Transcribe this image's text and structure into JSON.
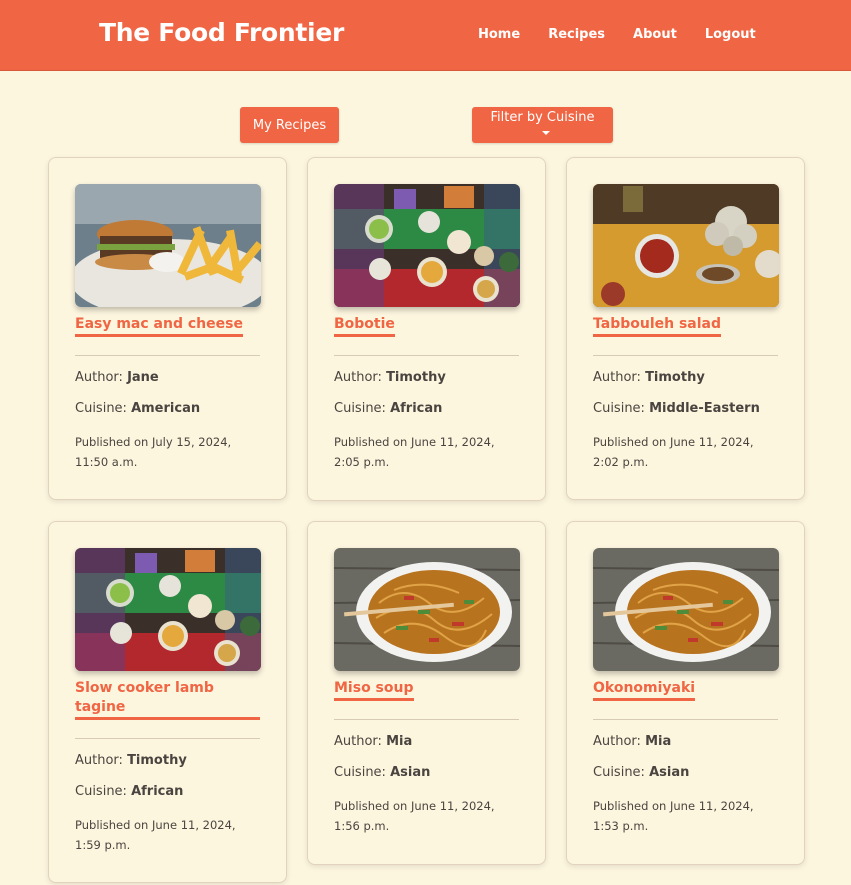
{
  "nav": {
    "brand": "The Food Frontier",
    "links": [
      "Home",
      "Recipes",
      "About",
      "Logout"
    ]
  },
  "controls": {
    "my_recipes": "My Recipes",
    "filter": "Filter by Cuisine"
  },
  "labels": {
    "author": "Author:",
    "cuisine": "Cuisine:"
  },
  "recipes": [
    {
      "title": "Easy mac and cheese",
      "author": "Jane",
      "cuisine": "American",
      "published": "Published on July 15, 2024, 11:50 a.m.",
      "image": "burger-fries-photo"
    },
    {
      "title": "Bobotie",
      "author": "Timothy",
      "cuisine": "African",
      "published": "Published on June 11, 2024, 2:05 p.m.",
      "image": "african-table-photo"
    },
    {
      "title": "Tabbouleh salad",
      "author": "Timothy",
      "cuisine": "Middle-Eastern",
      "published": "Published on June 11, 2024, 2:02 p.m.",
      "image": "spices-garlic-photo"
    },
    {
      "title": "Slow cooker lamb tagine",
      "author": "Timothy",
      "cuisine": "African",
      "published": "Published on June 11, 2024, 1:59 p.m.",
      "image": "african-table-photo"
    },
    {
      "title": "Miso soup",
      "author": "Mia",
      "cuisine": "Asian",
      "published": "Published on June 11, 2024, 1:56 p.m.",
      "image": "noodles-bowl-photo"
    },
    {
      "title": "Okonomiyaki",
      "author": "Mia",
      "cuisine": "Asian",
      "published": "Published on June 11, 2024, 1:53 p.m.",
      "image": "noodles-bowl-photo"
    }
  ],
  "colors": {
    "accent": "#f06543",
    "background": "#fdf6df",
    "text": "#4a4440"
  }
}
